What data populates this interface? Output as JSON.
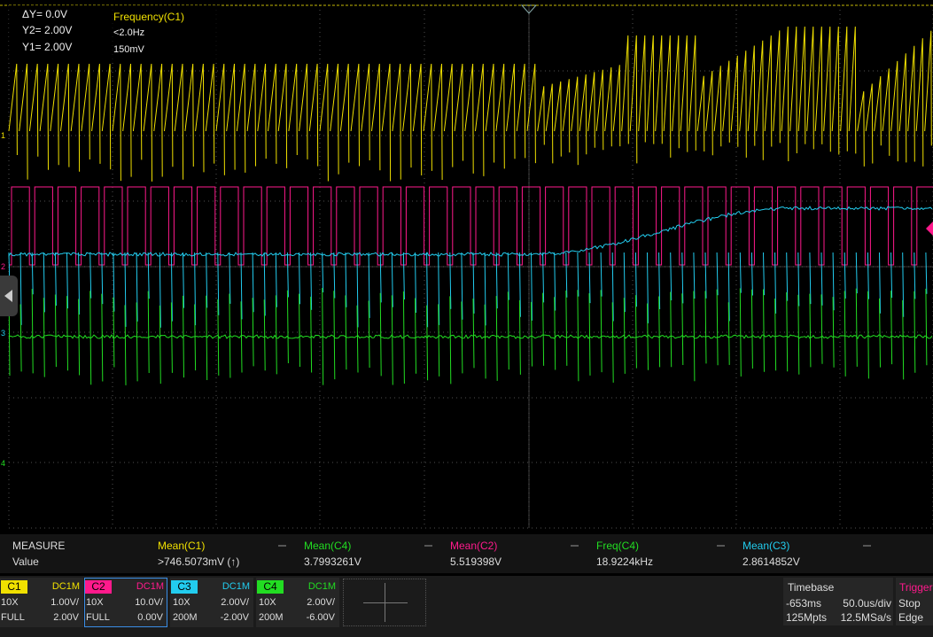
{
  "cursors": {
    "dy": "ΔY= 0.0V",
    "y2": "Y2= 2.00V",
    "y1": "Y1= 2.00V"
  },
  "quick_measure": {
    "title": "Frequency(C1)",
    "value1": "<2.0Hz",
    "value2": "150mV"
  },
  "channel_markers": [
    "1",
    "2",
    "3",
    "4"
  ],
  "measure": {
    "header": "MEASURE",
    "row_label": "Value",
    "items": [
      {
        "name": "Mean(C1)",
        "value": ">746.5073mV (↑)",
        "color": "#f0e000"
      },
      {
        "name": "Mean(C4)",
        "value": "3.7993261V",
        "color": "#22dd22"
      },
      {
        "name": "Mean(C2)",
        "value": "5.519398V",
        "color": "#ff1a8c"
      },
      {
        "name": "Freq(C4)",
        "value": "18.9224kHz",
        "color": "#22dd22"
      },
      {
        "name": "Mean(C3)",
        "value": "2.8614852V",
        "color": "#22ccee"
      }
    ]
  },
  "channels": [
    {
      "name": "C1",
      "coupling": "DC1M",
      "probe": "10X",
      "scale": "1.00V/",
      "bw": "FULL",
      "offset": "2.00V",
      "color": "#f0e000",
      "selected": false
    },
    {
      "name": "C2",
      "coupling": "DC1M",
      "probe": "10X",
      "scale": "10.0V/",
      "bw": "FULL",
      "offset": "0.00V",
      "color": "#ff1a8c",
      "selected": true
    },
    {
      "name": "C3",
      "coupling": "DC1M",
      "probe": "10X",
      "scale": "2.00V/",
      "bw": "200M",
      "offset": "-2.00V",
      "color": "#22ccee",
      "selected": false
    },
    {
      "name": "C4",
      "coupling": "DC1M",
      "probe": "10X",
      "scale": "2.00V/",
      "bw": "200M",
      "offset": "-6.00V",
      "color": "#22dd22",
      "selected": false
    }
  ],
  "timebase": {
    "title": "Timebase",
    "delay": "-653ms",
    "scale": "50.0us/div",
    "memory": "125Mpts",
    "rate": "12.5MSa/s"
  },
  "trigger": {
    "title": "Trigger",
    "state": "Stop",
    "type": "Edge",
    "color": "#ff1a8c"
  }
}
